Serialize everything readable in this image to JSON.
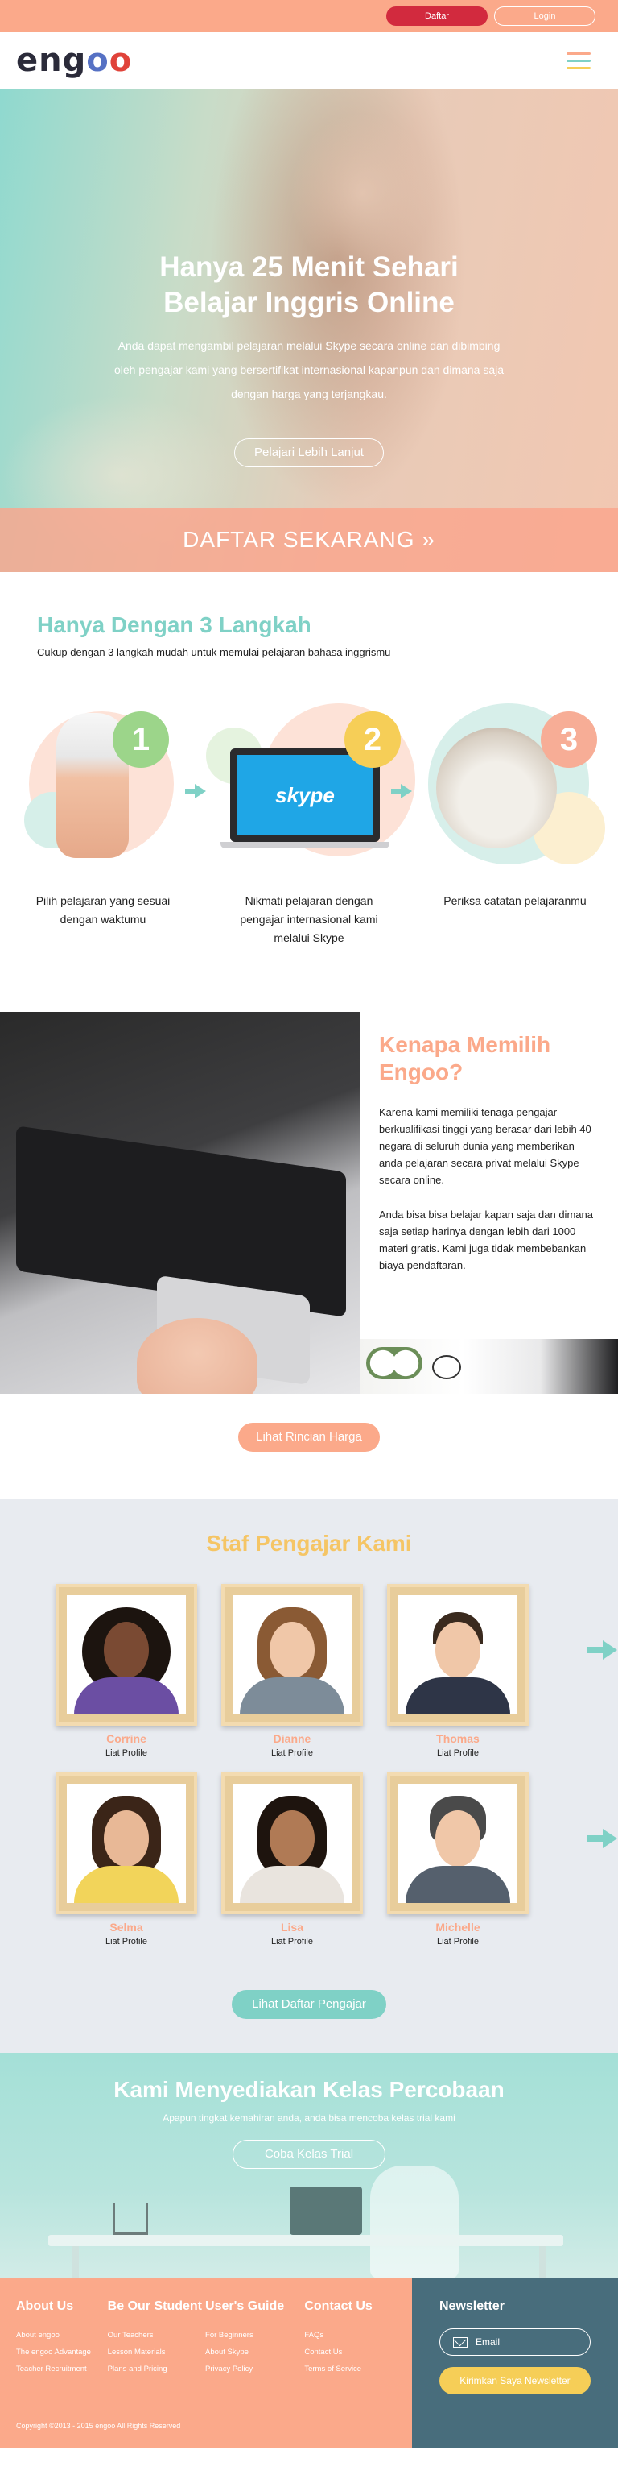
{
  "topbar": {
    "daftar_label": "Daftar",
    "login_label": "Login"
  },
  "nav": {
    "logo_text_a": "eng",
    "logo_o1": "o",
    "logo_o2": "o"
  },
  "hero": {
    "title_line1": "Hanya 25 Menit Sehari",
    "title_line2": "Belajar Inggris Online",
    "text": "Anda dapat mengambil pelajaran melalui Skype secara online dan dibimbing oleh pengajar kami yang bersertifikat internasional kapanpun dan dimana saja dengan harga yang terjangkau.",
    "button_label": "Pelajari Lebih Lanjut",
    "strip_label": "DAFTAR SEKARANG »"
  },
  "steps": {
    "title": "Hanya Dengan 3 Langkah",
    "subtitle": "Cukup dengan 3 langkah mudah untuk memulai pelajaran bahasa inggrismu",
    "items": [
      {
        "number": "1",
        "caption": "Pilih pelajaran yang sesuai dengan waktumu"
      },
      {
        "number": "2",
        "caption": "Nikmati pelajaran dengan pengajar internasional kami melalui Skype",
        "logo": "skype"
      },
      {
        "number": "3",
        "caption": "Periksa catatan pelajaranmu"
      }
    ]
  },
  "why": {
    "title": "Kenapa Memilih Engoo?",
    "para1": "Karena kami memiliki tenaga pengajar berkualifikasi tinggi yang berasar dari lebih 40 negara di seluruh dunia yang memberikan anda pelajaran secara privat melalui Skype secara online.",
    "para2": "Anda bisa bisa belajar kapan saja dan dimana saja setiap harinya dengan lebih dari 1000 materi gratis. Kami juga tidak membebankan biaya pendaftaran.",
    "button_label": "Lihat Rincian Harga"
  },
  "teachers": {
    "title": "Staf Pengajar Kami",
    "profile_label": "Liat Profile",
    "list": [
      {
        "name": "Corrine",
        "skin": "#7a4a33",
        "hair": "#1c140f",
        "shirt": "#6b4ea3"
      },
      {
        "name": "Dianne",
        "skin": "#f0c7a8",
        "hair": "#8a5a34",
        "shirt": "#7d8c99"
      },
      {
        "name": "Thomas",
        "skin": "#f0c7a8",
        "hair": "#3a2a1e",
        "shirt": "#2e3547"
      },
      {
        "name": "Selma",
        "skin": "#e8b896",
        "hair": "#3b2518",
        "shirt": "#f2d45a"
      },
      {
        "name": "Lisa",
        "skin": "#b07a55",
        "hair": "#1e140e",
        "shirt": "#e9e4de"
      },
      {
        "name": "Michelle",
        "skin": "#f0c7a8",
        "hair": "#4a4a4a",
        "shirt": "#55606d"
      }
    ],
    "button_label": "Lihat Daftar Pengajar"
  },
  "trial": {
    "title": "Kami Menyediakan Kelas Percobaan",
    "subtitle": "Apapun tingkat kemahiran anda, anda bisa mencoba kelas trial kami",
    "button_label": "Coba Kelas Trial"
  },
  "footer": {
    "columns": [
      {
        "title": "About Us",
        "links": [
          "About engoo",
          "The engoo Advantage",
          "Teacher Recruitment"
        ]
      },
      {
        "title": "Be Our Student",
        "links": [
          "Our Teachers",
          "Lesson Materials",
          "Plans and Pricing"
        ]
      },
      {
        "title": "User's Guide",
        "links": [
          "For Beginners",
          "About Skype",
          "Privacy Policy"
        ]
      },
      {
        "title": "Contact Us",
        "links": [
          "FAQs",
          "Contact Us",
          "Terms of Service"
        ]
      }
    ],
    "copyright": "Copyright ©2013 - 2015 engoo All Rights Reserved",
    "newsletter": {
      "title": "Newsletter",
      "email_placeholder": "Email",
      "button_label": "Kirimkan Saya Newsletter"
    }
  },
  "colors": {
    "coral": "#fba98a",
    "teal": "#7fd1c6",
    "yellow": "#f6ce57",
    "red": "#d22a3e",
    "navy": "#486d7c"
  }
}
